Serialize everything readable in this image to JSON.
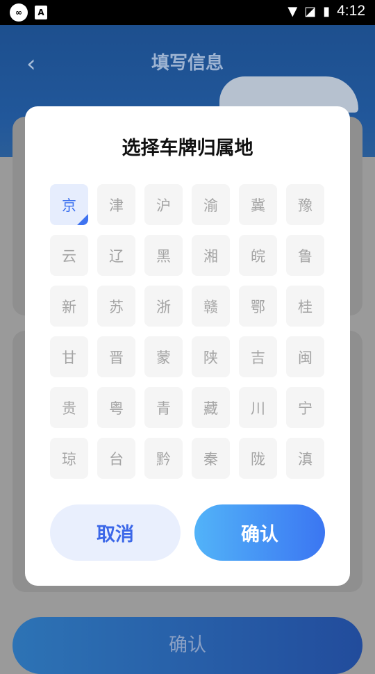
{
  "status_bar": {
    "time": "4:12",
    "icon_left_1": "∞",
    "icon_left_2": "A"
  },
  "background": {
    "title": "填写信息",
    "confirm_label": "确认"
  },
  "dialog": {
    "title": "选择车牌归属地",
    "provinces": [
      "京",
      "津",
      "沪",
      "渝",
      "冀",
      "豫",
      "云",
      "辽",
      "黑",
      "湘",
      "皖",
      "鲁",
      "新",
      "苏",
      "浙",
      "赣",
      "鄂",
      "桂",
      "甘",
      "晋",
      "蒙",
      "陕",
      "吉",
      "闽",
      "贵",
      "粤",
      "青",
      "藏",
      "川",
      "宁",
      "琼",
      "台",
      "黔",
      "秦",
      "陇",
      "滇"
    ],
    "selected": "京",
    "cancel_label": "取消",
    "confirm_label": "确认"
  },
  "colors": {
    "accent": "#3f73f0",
    "header": "#21579a"
  }
}
